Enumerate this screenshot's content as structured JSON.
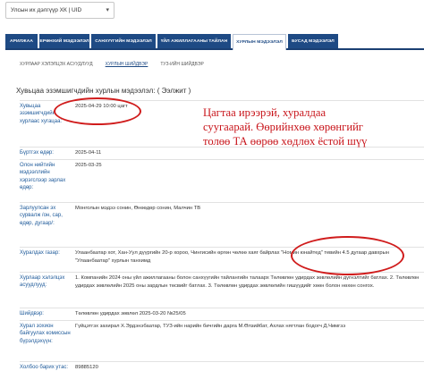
{
  "org_select": {
    "value": "Улсын их дэлгүүр ХК | UID",
    "caret_icon": "chevron-down-icon"
  },
  "tabs": [
    {
      "label": "АРИЛЖАА",
      "active": false
    },
    {
      "label": "ЕРӨНХИЙ МЭДЭЭЛЭЛ",
      "active": false
    },
    {
      "label": "САНХҮҮГИЙН МЭДЭЭЛЭЛ",
      "active": false
    },
    {
      "label": "ҮЙЛ АЖИЛЛАГААНЫ ТАЙЛАН",
      "active": false
    },
    {
      "label": "ХУРЛЫН МЭДЭЭЛЭЛ",
      "active": true
    },
    {
      "label": "БУСАД МЭДЭЭЛЭЛ",
      "active": false
    }
  ],
  "subnav": [
    {
      "label": "ХУРЛААР ХЭЛЭЛЦЭХ АСУУДЛУУД",
      "active": false
    },
    {
      "label": "ХУРЛЫН ШИЙДВЭР",
      "active": true
    },
    {
      "label": "ТУЗ-ИЙН ШИЙДВЭР",
      "active": false
    }
  ],
  "section_title": "Хувьцаа эзэмшигчдийн хурлын мэдээлэл: ( Ээлжит )",
  "fields": [
    {
      "label": "Хувьцаа эзэмшигчдийн хурлаас хугацаа:",
      "value": "2025-04-29 10:00 цагт"
    },
    {
      "label": "Бүртгэх өдөр:",
      "value": "2025-04-11"
    },
    {
      "label": "Олон нийтийн мэдээллийн хэрэгслээр зарлах өдөр:",
      "value": "2025-03-25"
    },
    {
      "label": "Зарлуулсан эх сурвалж /он, сар, өдөр, дугаар/:",
      "value": "Монголын мэдээ сонин, Өнөөдөр сонин, Малчин ТВ"
    },
    {
      "label": "Хуралдах газар:",
      "value": "Улаанбаатар хот, Хан-Уул дүүргийн 20-р хороо, Чингисийн өргөн чөлөө хаяг байрлах \"Номин юнайтед\" тевийн 4.5 дугаар давхрын \"Улаанбаатар\" хурлын танхимд"
    },
    {
      "label": "Хурлаар хэлэлцэх асуудлууд:",
      "value": "1. Компанийн 2024 оны үйл ажиллагааны болон санхүүгийн тайлангийн талаарх Төлөвлөн удирдах зөвлөлийн дүгнэлтийг батлах. 2. Төлөвлөн удирдах зөвлөлийн 2025 оны зардлын төсвийг батлах. 3. Төлөвлөн удирдах зөвлөлийн гишүүдийг хөөн болон нөхөн сонгох."
    },
    {
      "label": "Шийдвэр:",
      "value": "Төлөвлөн удирдах зөвлөл 2025-03-20 №25/05"
    },
    {
      "label": "Хурал зохион байгуулах комиссын бүрэлдэхүүн:",
      "value": "Гүйцэтгэх захирал Х.Эрдэнэбаатар, ТУЗ-ийн нарийн бичгийн дарга М.Өлзийбат, Ахлах нягтлан бодогч Д.Чимгээ"
    },
    {
      "label": "Холбоо барих утас:",
      "value": "89885120"
    }
  ],
  "annotation_note": "Цагтаа ирээрэй, хуралдаа суугаарай. Өөрийнхөө хөрөнгийг толөө ТА өөрөө хөдлөх ёстой шүү",
  "annotation_color": "#c8141a"
}
